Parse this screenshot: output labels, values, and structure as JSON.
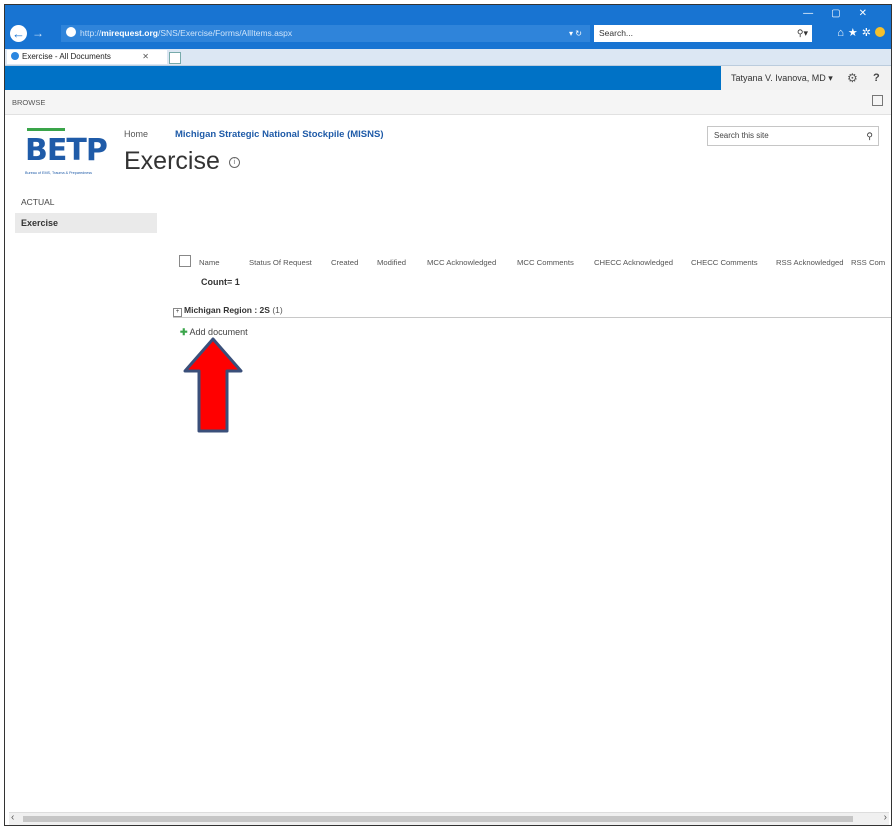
{
  "browser": {
    "url_prefix": "http://",
    "url_host": "mirequest.org",
    "url_path": "/SNS/Exercise/Forms/AllItems.aspx",
    "search_placeholder": "Search...",
    "tab_title": "Exercise - All Documents",
    "accent": "#1874d2"
  },
  "suite_bar": {
    "user_name": "Tatyana V. Ivanova, MD",
    "brand_color": "#0072c6"
  },
  "ribbon": {
    "browse_label": "BROWSE"
  },
  "site": {
    "logo_text": "BETP",
    "logo_subtitle": "Bureau of EMS, Trauma & Preparedness",
    "home_link": "Home",
    "site_title": "Michigan Strategic National Stockpile (MISNS)",
    "page_title": "Exercise",
    "search_placeholder": "Search this site"
  },
  "left_nav": {
    "section": "ACTUAL",
    "items": [
      {
        "label": "Exercise",
        "selected": true
      }
    ]
  },
  "list_view": {
    "columns": [
      "Name",
      "Status Of Request",
      "Created",
      "Modified",
      "MCC Acknowledged",
      "MCC Comments",
      "CHECC Acknowledged",
      "CHECC Comments",
      "RSS Acknowledged",
      "RSS Com"
    ],
    "count_label": "Count= 1",
    "group_label": "Michigan Region : 2S",
    "group_count": "(1)",
    "add_document": "Add document"
  },
  "annotation": {
    "arrow_color": "#ff0000",
    "arrow_outline": "#3a4f7a"
  }
}
